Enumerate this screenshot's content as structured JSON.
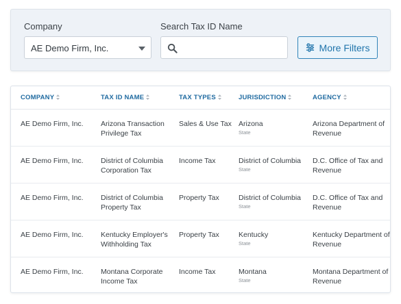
{
  "filters": {
    "company_label": "Company",
    "company_value": "AE Demo Firm, Inc.",
    "search_label": "Search Tax ID Name",
    "search_value": "",
    "search_placeholder": "",
    "more_filters_label": "More Filters"
  },
  "table": {
    "headers": [
      "COMPANY",
      "TAX ID NAME",
      "TAX TYPES",
      "JURISDICTION",
      "AGENCY"
    ],
    "rows": [
      {
        "company": "AE Demo Firm, Inc.",
        "tax_id_name": "Arizona Transaction Privilege Tax",
        "tax_types": "Sales & Use Tax",
        "jurisdiction": "Arizona",
        "jurisdiction_level": "State",
        "agency": "Arizona Department of Revenue"
      },
      {
        "company": "AE Demo Firm, Inc.",
        "tax_id_name": "District of Columbia Corporation Tax",
        "tax_types": "Income Tax",
        "jurisdiction": "District of Columbia",
        "jurisdiction_level": "State",
        "agency": "D.C. Office of Tax and Revenue"
      },
      {
        "company": "AE Demo Firm, Inc.",
        "tax_id_name": "District of Columbia Property Tax",
        "tax_types": "Property Tax",
        "jurisdiction": "District of Columbia",
        "jurisdiction_level": "State",
        "agency": "D.C. Office of Tax and Revenue"
      },
      {
        "company": "AE Demo Firm, Inc.",
        "tax_id_name": "Kentucky Employer's Withholding Tax",
        "tax_types": "Property Tax",
        "jurisdiction": "Kentucky",
        "jurisdiction_level": "State",
        "agency": "Kentucky Department of Revenue"
      },
      {
        "company": "AE Demo Firm, Inc.",
        "tax_id_name": "Montana Corporate Income Tax",
        "tax_types": "Income Tax",
        "jurisdiction": "Montana",
        "jurisdiction_level": "State",
        "agency": "Montana Department of Revenue"
      }
    ]
  },
  "icons": {
    "search": "search-icon",
    "filters": "sliders-icon",
    "sort": "sort-icon",
    "dropdown": "chevron-down-icon"
  },
  "colors": {
    "accent": "#1f74ab",
    "header_text": "#1f6aa0",
    "panel_bg": "#eef2f7"
  }
}
